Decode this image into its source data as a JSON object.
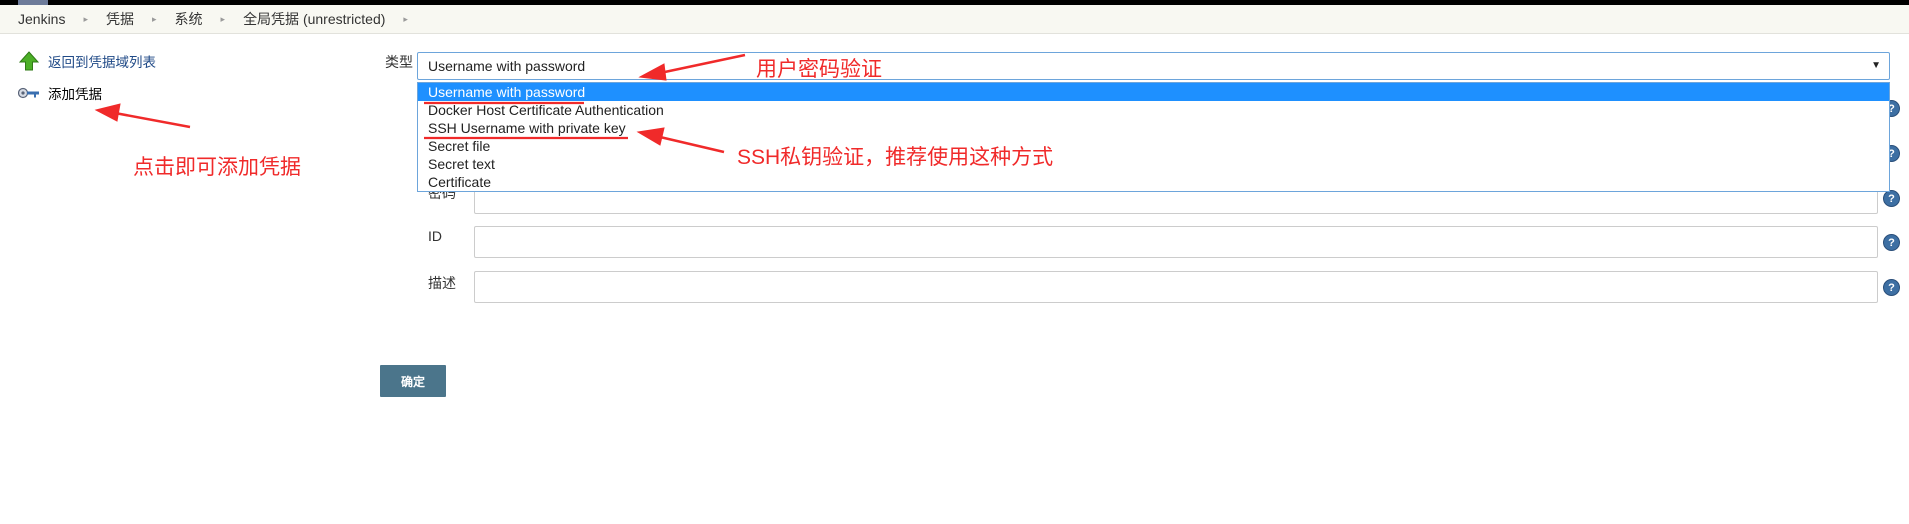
{
  "breadcrumb": [
    "Jenkins",
    "凭据",
    "系统",
    "全局凭据 (unrestricted)"
  ],
  "breadcrumb_separator": "▸",
  "sidebar": {
    "items": [
      {
        "label": "返回到凭据域列表",
        "icon": "up-arrow-icon"
      },
      {
        "label": "添加凭据",
        "icon": "key-icon"
      }
    ]
  },
  "form": {
    "type_label": "类型",
    "type_selected": "Username with password",
    "select_arrow": "▼",
    "options": [
      "Username with password",
      "Docker Host Certificate Authentication",
      "SSH Username with private key",
      "Secret file",
      "Secret text",
      "Certificate"
    ],
    "partial_label": "密码",
    "id_label": "ID",
    "description_label": "描述",
    "help_glyph": "?",
    "submit_label": "确定"
  },
  "annotations": {
    "username_password": "用户密码验证",
    "ssh_key": "SSH私钥验证，推荐使用这种方式",
    "add_credential": "点击即可添加凭据"
  },
  "colors": {
    "annotation": "#f02a2a",
    "selected_option": "#1e90ff",
    "button": "#4b758b",
    "link": "#204a87"
  }
}
